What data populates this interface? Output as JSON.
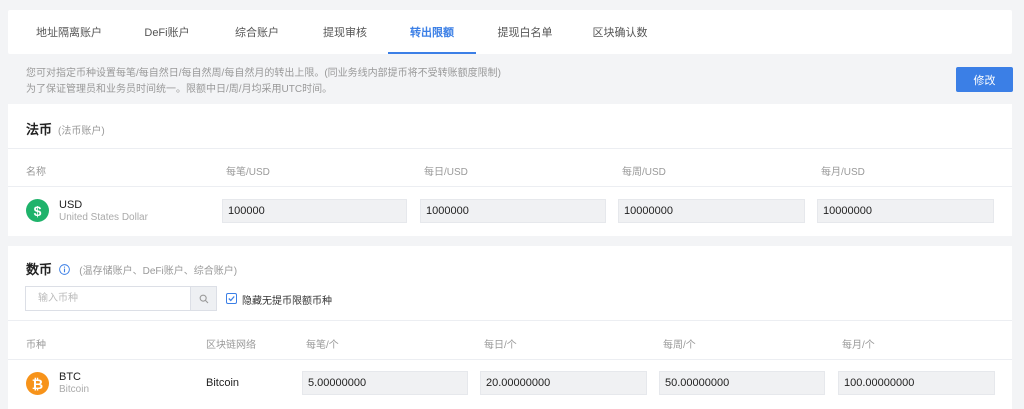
{
  "tabs": [
    {
      "label": "地址隔离账户",
      "active": false
    },
    {
      "label": "DeFi账户",
      "active": false
    },
    {
      "label": "综合账户",
      "active": false
    },
    {
      "label": "提现审核",
      "active": false
    },
    {
      "label": "转出限额",
      "active": true
    },
    {
      "label": "提现白名单",
      "active": false
    },
    {
      "label": "区块确认数",
      "active": false
    }
  ],
  "notice": {
    "line1": "您可对指定币种设置每笔/每自然日/每自然周/每自然月的转出上限。(同业务线内部提币将不受转账额度限制)",
    "line2": "为了保证管理员和业务员时间统一。限额中日/周/月均采用UTC时间。"
  },
  "edit_button": "修改",
  "fiat": {
    "title": "法币",
    "subtitle": "(法币账户)",
    "columns": [
      "名称",
      "每笔/USD",
      "每日/USD",
      "每周/USD",
      "每月/USD"
    ],
    "rows": [
      {
        "code": "USD",
        "name": "United States Dollar",
        "icon": "dollar-icon",
        "icon_color": "#1fb36b",
        "icon_glyph": "$",
        "values": [
          "100000",
          "1000000",
          "10000000",
          "10000000"
        ]
      }
    ]
  },
  "crypto": {
    "title": "数币",
    "subtitle": "(温存储账户、DeFi账户、综合账户)",
    "search_placeholder": "输入币种",
    "hide_label": "隐藏无提币限额币种",
    "hide_checked": true,
    "columns": [
      "币种",
      "区块链网络",
      "每笔/个",
      "每日/个",
      "每周/个",
      "每月/个"
    ],
    "rows": [
      {
        "code": "BTC",
        "name": "Bitcoin",
        "network": "Bitcoin",
        "icon": "bitcoin-icon",
        "icon_color": "#f7931a",
        "icon_glyph": "₿",
        "values": [
          "5.00000000",
          "20.00000000",
          "50.00000000",
          "100.00000000"
        ]
      }
    ]
  },
  "colors": {
    "accent": "#3b7fe6"
  }
}
